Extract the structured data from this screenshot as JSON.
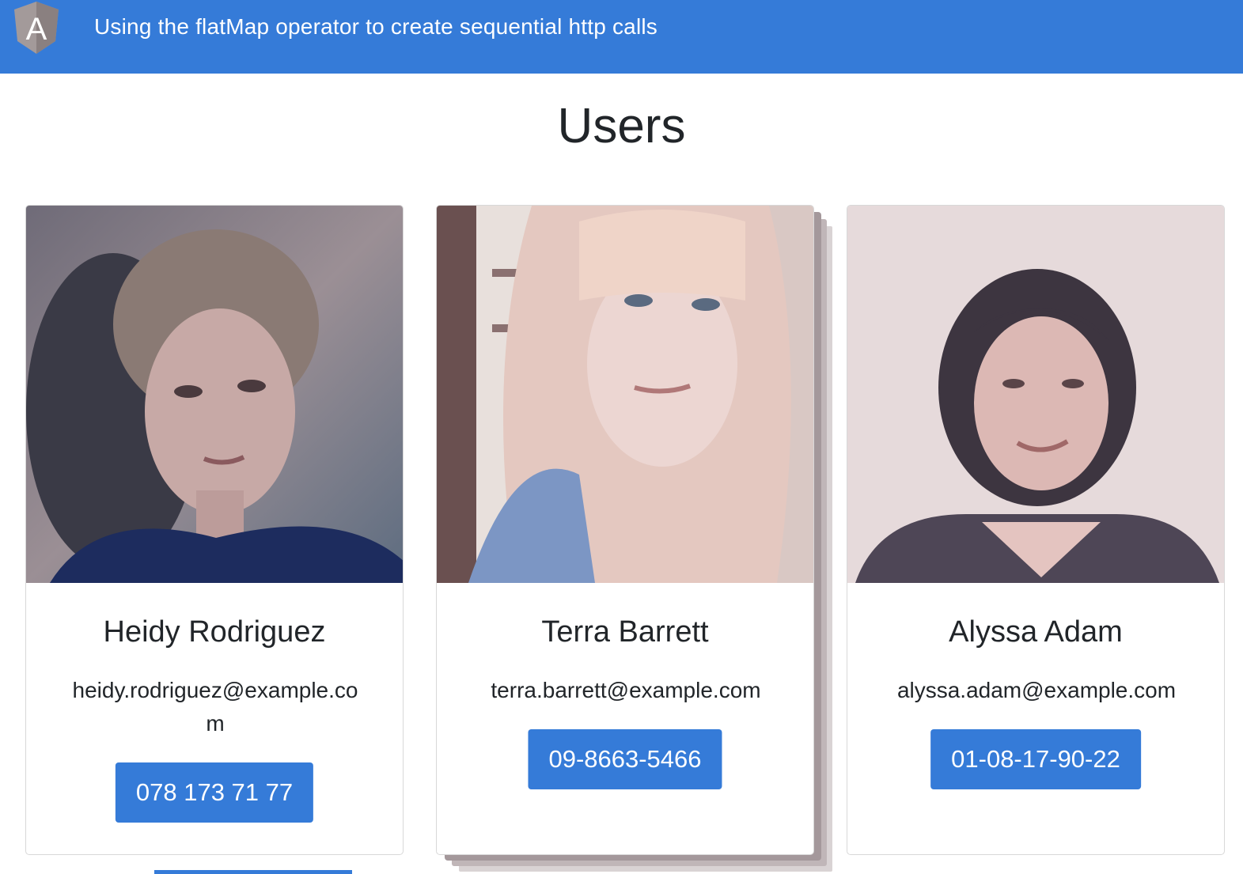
{
  "navbar": {
    "logo_icon": "angular-logo-icon",
    "logo_letter": "A",
    "title": "Using the flatMap operator to create sequential http calls",
    "background": "#357bd8"
  },
  "page": {
    "title": "Users"
  },
  "users": [
    {
      "name": "Heidy Rodriguez",
      "email": "heidy.rodriguez@example.com",
      "phone": "078 173 71 77",
      "photo_icon": "user-photo"
    },
    {
      "name": "Terra Barrett",
      "email": "terra.barrett@example.com",
      "phone": "09-8663-5466",
      "photo_icon": "user-photo"
    },
    {
      "name": "Alyssa Adam",
      "email": "alyssa.adam@example.com",
      "phone": "01-08-17-90-22",
      "photo_icon": "user-photo"
    }
  ],
  "colors": {
    "primary": "#357bd8",
    "text": "#212529"
  }
}
